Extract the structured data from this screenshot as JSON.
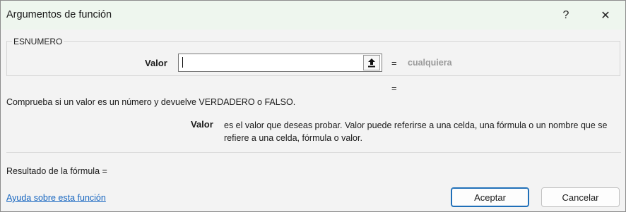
{
  "window": {
    "title": "Argumentos de función",
    "help_glyph": "?",
    "close_glyph": "✕"
  },
  "function_group": {
    "name": "ESNUMERO",
    "argument_label": "Valor",
    "argument_value": "",
    "equals": "=",
    "argument_result": "cualquiera",
    "function_equals": "="
  },
  "description": {
    "summary": "Comprueba si un valor es un número y devuelve VERDADERO o FALSO.",
    "argument_name": "Valor",
    "argument_text": "es el valor que deseas probar. Valor puede referirse a una celda, una fórmula o un nombre que se refiere a una celda, fórmula o valor."
  },
  "result": {
    "label": "Resultado de la fórmula ="
  },
  "footer": {
    "help_link": "Ayuda sobre esta función",
    "ok_label": "Aceptar",
    "cancel_label": "Cancelar"
  },
  "icons": {
    "collapse": "collapse-dialog-icon",
    "help": "question-mark-icon",
    "close": "close-icon"
  },
  "colors": {
    "titlebar": "#eef6ee",
    "link": "#1565c0",
    "accent_border": "#1f6fb8",
    "muted_result": "#9a9a9a"
  }
}
